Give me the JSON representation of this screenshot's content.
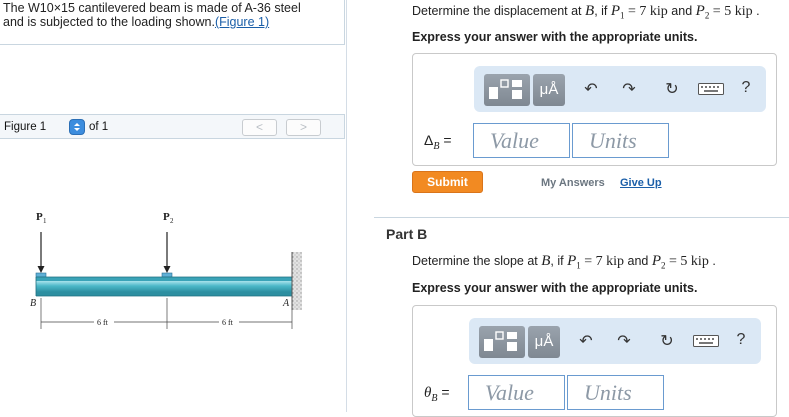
{
  "problem": {
    "line1": "The W10×15 cantilevered beam is made of A-36 steel",
    "line2_prefix": "and is subjected to the loading shown.",
    "figure_link": "(Figure 1)"
  },
  "figure_bar": {
    "label": "Figure 1",
    "of_text": "of 1",
    "prev": "<",
    "next": ">"
  },
  "figure": {
    "load_1": "P",
    "load_1_sub": "1",
    "load_2": "P",
    "load_2_sub": "2",
    "point_b": "B",
    "point_a": "A",
    "dim_1": "6 ft",
    "dim_2": "6 ft"
  },
  "part_a": {
    "prompt_prefix": "Determine the displacement at ",
    "point": "B",
    "prompt_mid": ", if ",
    "p1": "P",
    "p1_sub": "1",
    "p1_value": "= 7 kip",
    "and_text": "and",
    "p2": "P",
    "p2_sub": "2",
    "p2_value": "= 5 kip",
    "end": ".",
    "instruction": "Express your answer with the appropriate units.",
    "var_symbol": "Δ",
    "var_sub": "B",
    "equals": "=",
    "value_placeholder": "Value",
    "units_placeholder": "Units",
    "submit": "Submit",
    "my_answers": "My Answers",
    "give_up": "Give Up"
  },
  "toolbar": {
    "micro_label": "μÅ",
    "undo": "↶",
    "redo": "↷",
    "reset": "↻",
    "help": "?"
  },
  "part_b": {
    "title": "Part B",
    "prompt_prefix": "Determine the slope at ",
    "point": "B",
    "prompt_mid": ", if ",
    "p1": "P",
    "p1_sub": "1",
    "p1_value": "= 7 kip",
    "and_text": "and",
    "p2": "P",
    "p2_sub": "2",
    "p2_value": "= 5 kip",
    "end": ".",
    "instruction": "Express your answer with the appropriate units.",
    "var_symbol": "θ",
    "var_sub": "B",
    "equals": "=",
    "value_placeholder": "Value",
    "units_placeholder": "Units"
  },
  "colors": {
    "link": "#1a5ea8",
    "submit": "#f28a22",
    "toolbar_bg": "#dbe8f5",
    "field_border": "#6a9bd0",
    "beam": "#4cb8c8"
  }
}
